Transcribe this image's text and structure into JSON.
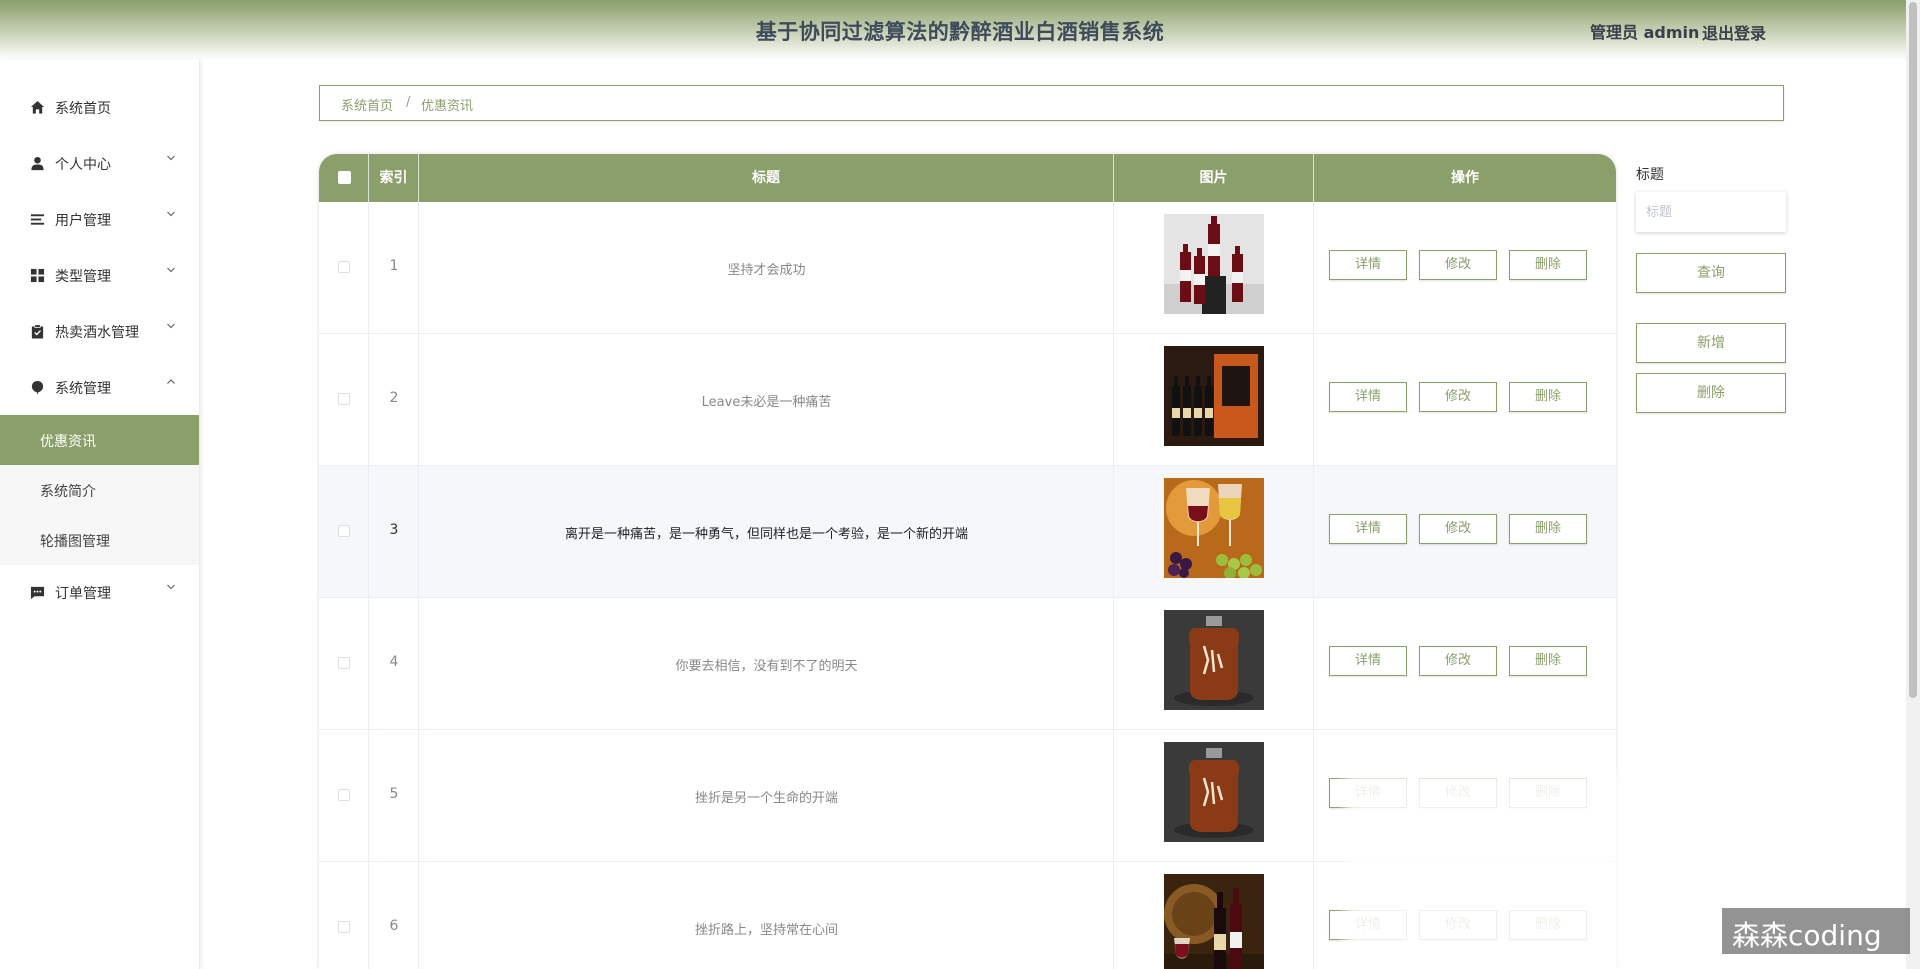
{
  "header": {
    "title": "基于协同过滤算法的黔醉酒业白酒销售系统",
    "user": "管理员 admin",
    "logout": "退出登录"
  },
  "sidebar": {
    "items": [
      {
        "label": "系统首页",
        "icon": "home-icon"
      },
      {
        "label": "个人中心",
        "icon": "user-icon",
        "expanded": false
      },
      {
        "label": "用户管理",
        "icon": "list-icon",
        "expanded": false
      },
      {
        "label": "类型管理",
        "icon": "grid-icon",
        "expanded": false
      },
      {
        "label": "热卖酒水管理",
        "icon": "clipboard-icon",
        "expanded": false
      },
      {
        "label": "系统管理",
        "icon": "balloon-icon",
        "expanded": true
      },
      {
        "label": "订单管理",
        "icon": "chat-icon",
        "expanded": false
      }
    ],
    "submenu": [
      {
        "label": "优惠资讯",
        "active": true
      },
      {
        "label": "系统简介",
        "active": false
      },
      {
        "label": "轮播图管理",
        "active": false
      }
    ]
  },
  "breadcrumb": {
    "home": "系统首页",
    "separator": "/",
    "current": "优惠资讯"
  },
  "table": {
    "columns": [
      "索引",
      "标题",
      "图片",
      "操作"
    ],
    "rows": [
      {
        "index": "1",
        "title": "坚持才会成功",
        "image": "red-wine-bottles-image"
      },
      {
        "index": "2",
        "title": "Leave未必是一种痛苦",
        "image": "wine-gift-box-image"
      },
      {
        "index": "3",
        "title": "离开是一种痛苦，是一种勇气，但同样也是一个考验，是一个新的开端",
        "image": "wine-glasses-grapes-image"
      },
      {
        "index": "4",
        "title": "你要去相信，没有到不了的明天",
        "image": "liquor-jar-image"
      },
      {
        "index": "5",
        "title": "挫折是另一个生命的开端",
        "image": "liquor-jar-image"
      },
      {
        "index": "6",
        "title": "挫折路上，坚持常在心间",
        "image": "wine-cellar-image"
      }
    ],
    "actions": {
      "detail": "详情",
      "edit": "修改",
      "delete": "删除"
    },
    "highlight_row": 3
  },
  "search": {
    "label": "标题",
    "placeholder": "标题",
    "value": "",
    "query_btn": "查询",
    "add_btn": "新增",
    "delete_btn": "删除"
  },
  "watermark": "森森coding",
  "colors": {
    "accent": "#8a9f6a",
    "header_text": "#3f4b5a"
  }
}
